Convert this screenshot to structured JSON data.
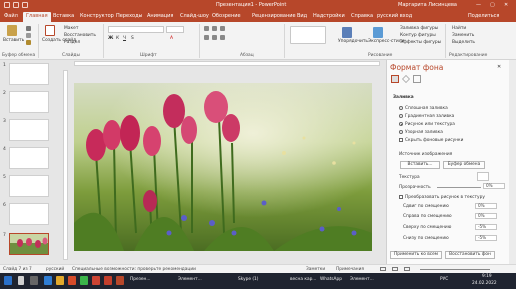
{
  "window": {
    "title": "Презентация1 - PowerPoint",
    "user": "Маргарита Лисинцева"
  },
  "tabs": [
    "Файл",
    "Главная",
    "Вставка",
    "Конструктор",
    "Переходы",
    "Анимация",
    "Слайд-шоу",
    "Обозрение",
    "Рецензирование",
    "Вид",
    "Надстройки",
    "Справка",
    "русский вход",
    "Поделиться"
  ],
  "ribbon": {
    "paste": "Вставить",
    "clipboard_group": "Буфер обмена",
    "cut": "Макет",
    "reset": "Восстановить",
    "section": "Раздел",
    "new_slide": "Создать слайд",
    "slides_group": "Слайды",
    "font_group": "Шрифт",
    "paragraph_group": "Абзац",
    "drawing_group": "Рисование",
    "arrange": "Упорядочить",
    "quick_styles": "Экспресс-стили",
    "shape_fill": "Заливка фигуры",
    "shape_outline": "Контур фигуры",
    "shape_effects": "Эффекты фигуры",
    "find": "Найти",
    "replace": "Заменить",
    "select": "Выделить",
    "editing_group": "Редактирование"
  },
  "thumbnails": [
    "1",
    "2",
    "3",
    "4",
    "5",
    "6",
    "7"
  ],
  "format_pane": {
    "title": "Формат фона",
    "section": "Заливка",
    "options": [
      "Сплошная заливка",
      "Градиентная заливка",
      "Рисунок или текстура",
      "Узорная заливка"
    ],
    "selected_option": 2,
    "hide_bg": "Скрыть фоновые рисунки",
    "image_source": "Источник изображения",
    "insert_btn": "Вставить...",
    "clipboard_btn": "Буфер обмена",
    "texture": "Текстура",
    "transparency": "Прозрачность",
    "transparency_value": "0%",
    "tile_check": "Преобразовать рисунок в текстуру",
    "offset_left": "Сдвиг по смещению",
    "offset_left_value": "0%",
    "offset_right": "Справа по смещению",
    "offset_right_value": "0%",
    "offset_top": "Сверху по смещению",
    "offset_top_value": "-5%",
    "offset_bottom": "Снизу по смещению",
    "offset_bottom_value": "-5%",
    "apply_all": "Применить ко всем",
    "reset_bg": "Восстановить фон"
  },
  "status": {
    "slide": "Слайд 7 из 7",
    "lang": "русский",
    "accessibility": "Специальные возможности: проверьте рекомендации",
    "notes": "Заметки",
    "comments": "Примечания"
  },
  "taskbar": {
    "items": [
      "Презен...",
      "Элемент...",
      "Skype (1)",
      "весна кар...",
      "WhatsApp",
      "Элемент..."
    ],
    "lang": "РУС",
    "time": "9:19",
    "date": "24.02.2022"
  },
  "colors": {
    "accent": "#b7472a",
    "taskbar": "#1f2430"
  }
}
